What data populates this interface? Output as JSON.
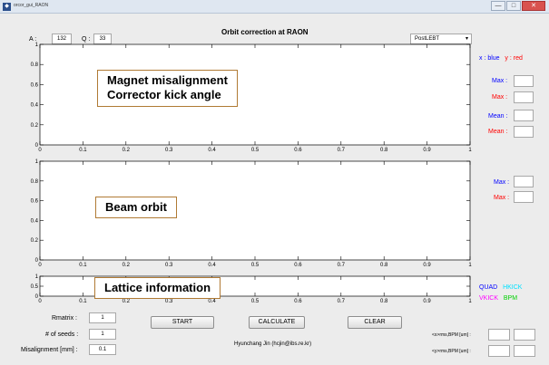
{
  "window": {
    "title": "orcor_gui_RAON",
    "app_icon": "matlab-figure-icon",
    "minimize": "—",
    "maximize": "□",
    "close": "✕"
  },
  "header": {
    "a_label": "A :",
    "a_value": "132",
    "q_label": "Q :",
    "q_value": "33",
    "title": "Orbit correction at RAON",
    "section_select": "PostLEBT",
    "select_caret": "▾"
  },
  "legend_top": {
    "x_label": "x : blue",
    "y_label": "y : red",
    "x_color": "#0000ff",
    "y_color": "#ff0000"
  },
  "stats_top": {
    "max_blue": "Max :",
    "max_red": "Max :",
    "mean_blue": "Mean :",
    "mean_red": "Mean :"
  },
  "stats_mid": {
    "max_blue": "Max :",
    "max_red": "Max :"
  },
  "legend_bottom": {
    "quad": "QUAD",
    "hkick": "HKICK",
    "vkick": "VKICK",
    "bpm": "BPM",
    "quad_color": "#0000ff",
    "hkick_color": "#00ffff",
    "vkick_color": "#ff00ff",
    "bpm_color": "#00ff00"
  },
  "annotations": {
    "plot1_line1": "Magnet misalignment",
    "plot1_line2": "Corrector kick angle",
    "plot2": "Beam orbit",
    "plot3": "Lattice information"
  },
  "controls": {
    "rmatrix_label": "Rmatrix :",
    "rmatrix_value": "1",
    "seeds_label": "# of seeds :",
    "seeds_value": "1",
    "misalign_label": "Misalignment [mm] :",
    "misalign_value": "0.1",
    "start": "START",
    "calculate": "CALCULATE",
    "clear": "CLEAR",
    "x_rms_label": "<x>rms,BPM [um] :",
    "y_rms_label": "<y>rms,BPM [um] :"
  },
  "footer": "Hyunchang Jin (hcjin@ibs.re.kr)",
  "chart_data": [
    {
      "type": "line",
      "xlim": [
        0,
        1
      ],
      "ylim": [
        0,
        1
      ],
      "xticks": [
        "0",
        "0.1",
        "0.2",
        "0.3",
        "0.4",
        "0.5",
        "0.6",
        "0.7",
        "0.8",
        "0.9",
        "1"
      ],
      "yticks": [
        "0",
        "0.2",
        "0.4",
        "0.6",
        "0.8",
        "1"
      ],
      "series": []
    },
    {
      "type": "line",
      "xlim": [
        0,
        1
      ],
      "ylim": [
        0,
        1
      ],
      "xticks": [
        "0",
        "0.1",
        "0.2",
        "0.3",
        "0.4",
        "0.5",
        "0.6",
        "0.7",
        "0.8",
        "0.9",
        "1"
      ],
      "yticks": [
        "0",
        "0.2",
        "0.4",
        "0.6",
        "0.8",
        "1"
      ],
      "series": []
    },
    {
      "type": "line",
      "xlim": [
        0,
        1
      ],
      "ylim": [
        0,
        1
      ],
      "xticks": [
        "0",
        "0.1",
        "0.2",
        "0.3",
        "0.4",
        "0.5",
        "0.6",
        "0.7",
        "0.8",
        "0.9",
        "1"
      ],
      "yticks": [
        "0",
        "0.5",
        "1"
      ],
      "series": []
    }
  ]
}
